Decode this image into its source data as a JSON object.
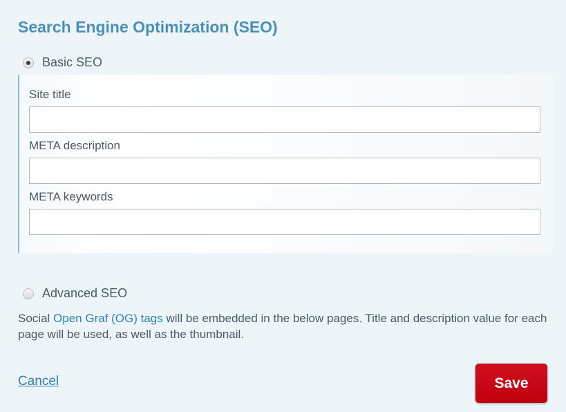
{
  "header": {
    "title": "Search Engine Optimization (SEO)"
  },
  "basic": {
    "label": "Basic SEO",
    "selected": true,
    "fields": [
      {
        "label": "Site title",
        "value": ""
      },
      {
        "label": "META description",
        "value": ""
      },
      {
        "label": "META keywords",
        "value": ""
      }
    ]
  },
  "advanced": {
    "label": "Advanced SEO",
    "selected": false,
    "desc_prefix": "Social ",
    "desc_link": "Open Graf (OG) tags",
    "desc_suffix": " will be embedded in the below pages. Title and description value for each page will be used, as well as the thumbnail."
  },
  "footer": {
    "cancel_label": "Cancel",
    "save_label": "Save"
  },
  "colors": {
    "background": "#eef5f9",
    "title": "#4a8fb8",
    "link": "#2f7fb3",
    "save": "#c8001a",
    "panel_border": "#8fb6cc"
  }
}
